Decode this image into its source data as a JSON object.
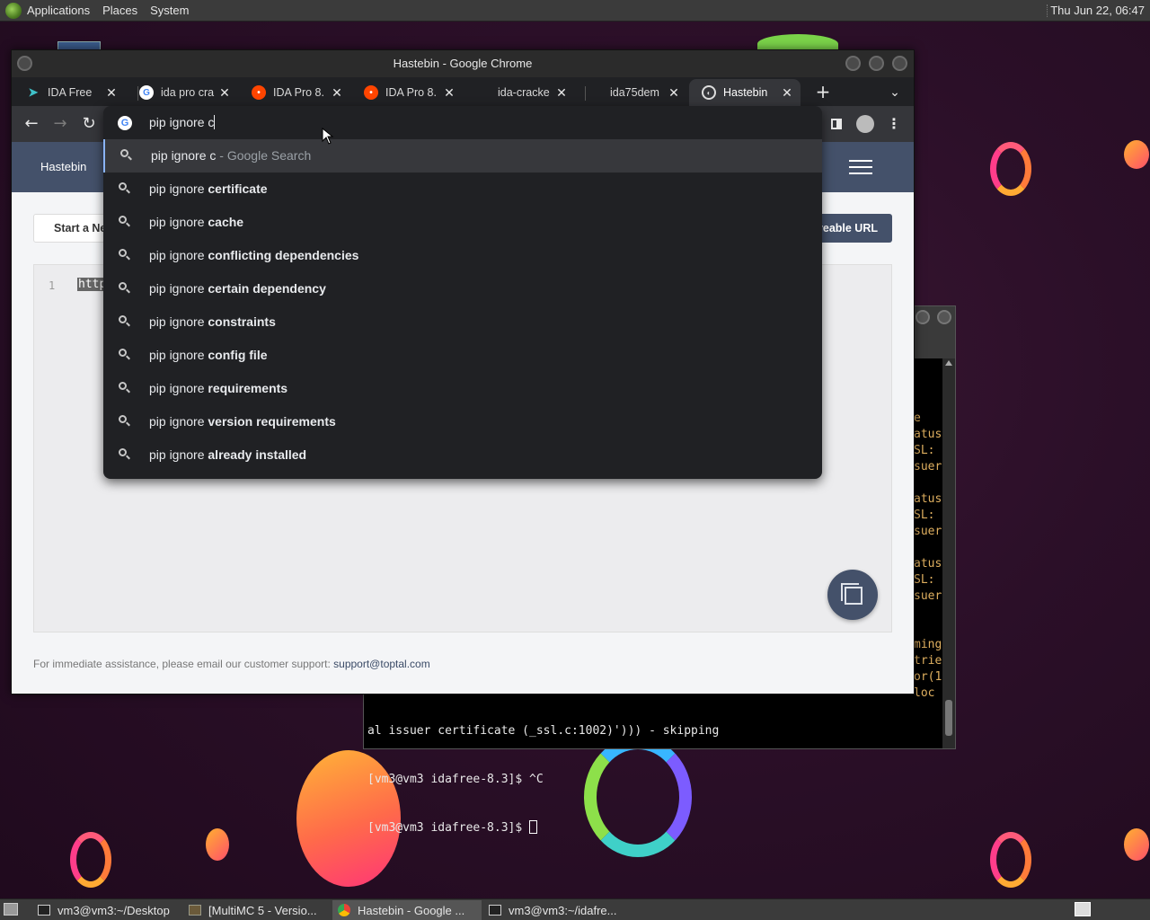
{
  "top_panel": {
    "menus": [
      "Applications",
      "Places",
      "System"
    ],
    "clock": "Thu Jun 22, 06:47"
  },
  "chrome": {
    "window_title": "Hastebin - Google Chrome",
    "tabs": [
      {
        "title": "IDA Free",
        "favicon": "ida-icon",
        "active": false
      },
      {
        "title": "ida pro cra",
        "favicon": "google-icon",
        "active": false
      },
      {
        "title": "IDA Pro 8.",
        "favicon": "reddit-icon",
        "active": false
      },
      {
        "title": "IDA Pro 8.",
        "favicon": "reddit-icon",
        "active": false
      },
      {
        "title": "ida-cracke",
        "favicon": "none",
        "active": false
      },
      {
        "title": "ida75dem",
        "favicon": "none",
        "active": false
      },
      {
        "title": "Hastebin",
        "favicon": "globe-icon",
        "active": true
      }
    ],
    "omnibox": {
      "query": "pip ignore c",
      "suggestions": [
        {
          "prefix": "pip ignore c",
          "bold": "",
          "suffix": " - Google Search",
          "highlighted": true
        },
        {
          "prefix": "pip ignore ",
          "bold": "certificate",
          "suffix": "",
          "highlighted": false
        },
        {
          "prefix": "pip ignore ",
          "bold": "cache",
          "suffix": "",
          "highlighted": false
        },
        {
          "prefix": "pip ignore ",
          "bold": "conflicting dependencies",
          "suffix": "",
          "highlighted": false
        },
        {
          "prefix": "pip ignore ",
          "bold": "certain dependency",
          "suffix": "",
          "highlighted": false
        },
        {
          "prefix": "pip ignore ",
          "bold": "constraints",
          "suffix": "",
          "highlighted": false
        },
        {
          "prefix": "pip ignore ",
          "bold": "config file",
          "suffix": "",
          "highlighted": false
        },
        {
          "prefix": "pip ignore ",
          "bold": "requirements",
          "suffix": "",
          "highlighted": false
        },
        {
          "prefix": "pip ignore ",
          "bold": "version requirements",
          "suffix": "",
          "highlighted": false
        },
        {
          "prefix": "pip ignore ",
          "bold": "already installed",
          "suffix": "",
          "highlighted": false
        }
      ]
    }
  },
  "page": {
    "brand": "Hastebin",
    "new_button": "Start a Ne",
    "share_button": "reable URL",
    "line_number": "1",
    "code": "http",
    "support_text": "For immediate assistance, please email our customer support: ",
    "support_email": "support@toptal.com"
  },
  "terminal": {
    "side_fragments": [
      "e",
      "atus",
      "SL:",
      "suer",
      "",
      "atus",
      "SL:",
      "suer",
      "",
      "atus",
      "SL:",
      "suer",
      "",
      "",
      "ming",
      "trie",
      "or(1",
      "loc"
    ],
    "lines": [
      "al issuer certificate (_ssl.c:1002)'))) - skipping",
      "[vm3@vm3 idafree-8.3]$ ^C",
      "[vm3@vm3 idafree-8.3]$ "
    ]
  },
  "taskbar": {
    "tasks": [
      {
        "label": "vm3@vm3:~/Desktop",
        "icon": "terminal-icon",
        "active": false
      },
      {
        "label": "[MultiMC 5 - Versio...",
        "icon": "multimc-icon",
        "active": false
      },
      {
        "label": "Hastebin - Google ...",
        "icon": "chrome-icon",
        "active": true
      },
      {
        "label": "vm3@vm3:~/idafre...",
        "icon": "terminal-icon",
        "active": false
      }
    ]
  },
  "colors": {
    "nav_bar": "#44516a",
    "omnibox_bg": "#202124",
    "desktop_bg": "#2b0f28"
  }
}
